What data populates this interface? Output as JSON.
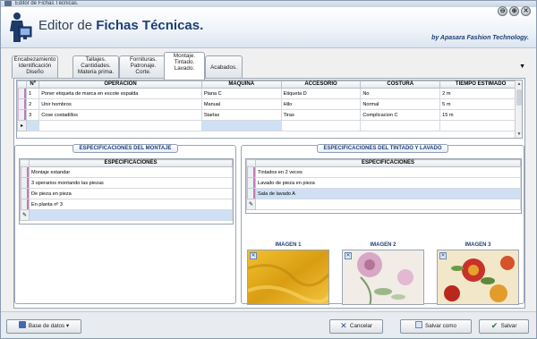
{
  "window": {
    "title": "Editor de Fichas Técnicas."
  },
  "header": {
    "title_prefix": "Editor de ",
    "title_bold": "Fichas Técnicas.",
    "byline": "by Apasara Fashion Technology.",
    "window_buttons": [
      "⊖",
      "⊕",
      "✕"
    ]
  },
  "tabs": [
    {
      "label": "Encabezamiento\nIdentificación\nDiseño"
    },
    {
      "label": "Tallajes.\nCantidades.\nMateria prima."
    },
    {
      "label": "Fornituras.\nPatronaje.\nCorte."
    },
    {
      "label": "Montaje.\nTintado.\nLavado."
    },
    {
      "label": "Acabados."
    }
  ],
  "tab_menu_icon": "▼",
  "operations_grid": {
    "headers": [
      "Nº",
      "OPERACION",
      "MAQUINA",
      "ACCESORIO",
      "COSTURA",
      "TIEMPO ESTIMADO"
    ],
    "rows": [
      [
        "1",
        "Poner etiqueta de marca en escote espalda",
        "Plana C",
        "Etiqueta D",
        "No",
        "2 m"
      ],
      [
        "2",
        "Unir hombros",
        "Manual",
        "Hilo",
        "Normal",
        "5 m"
      ],
      [
        "3",
        "Cose costadillos",
        "Starlax",
        "Tiras",
        "Complicacion C",
        "15 m"
      ]
    ]
  },
  "montaje": {
    "title": "ESPECIFICACIONES DEL MONTAJE",
    "header": "ESPECIFICACIONES",
    "rows": [
      "Montaje estandar",
      "3 operarios montando las piezas",
      "De pieza en pieza",
      "En planta nº 3"
    ]
  },
  "tintado": {
    "title": "ESPECIFICACIONES DEL TINTADO Y LAVADO",
    "header": "ESPECIFICACIONES",
    "rows": [
      "Tintados en 2 veces",
      "Lavado de pieza en pieza",
      "Sala de lavado A"
    ]
  },
  "images": [
    {
      "label": "IMAGEN 1"
    },
    {
      "label": "IMAGEN 2"
    },
    {
      "label": "IMAGEN 3"
    }
  ],
  "buttons": {
    "database": "Base de datos",
    "cancel": "Cancelar",
    "save_as": "Salvar como",
    "save": "Salvar"
  },
  "colors": {
    "accent": "#1f3f75",
    "selection": "#cfe0f5"
  }
}
